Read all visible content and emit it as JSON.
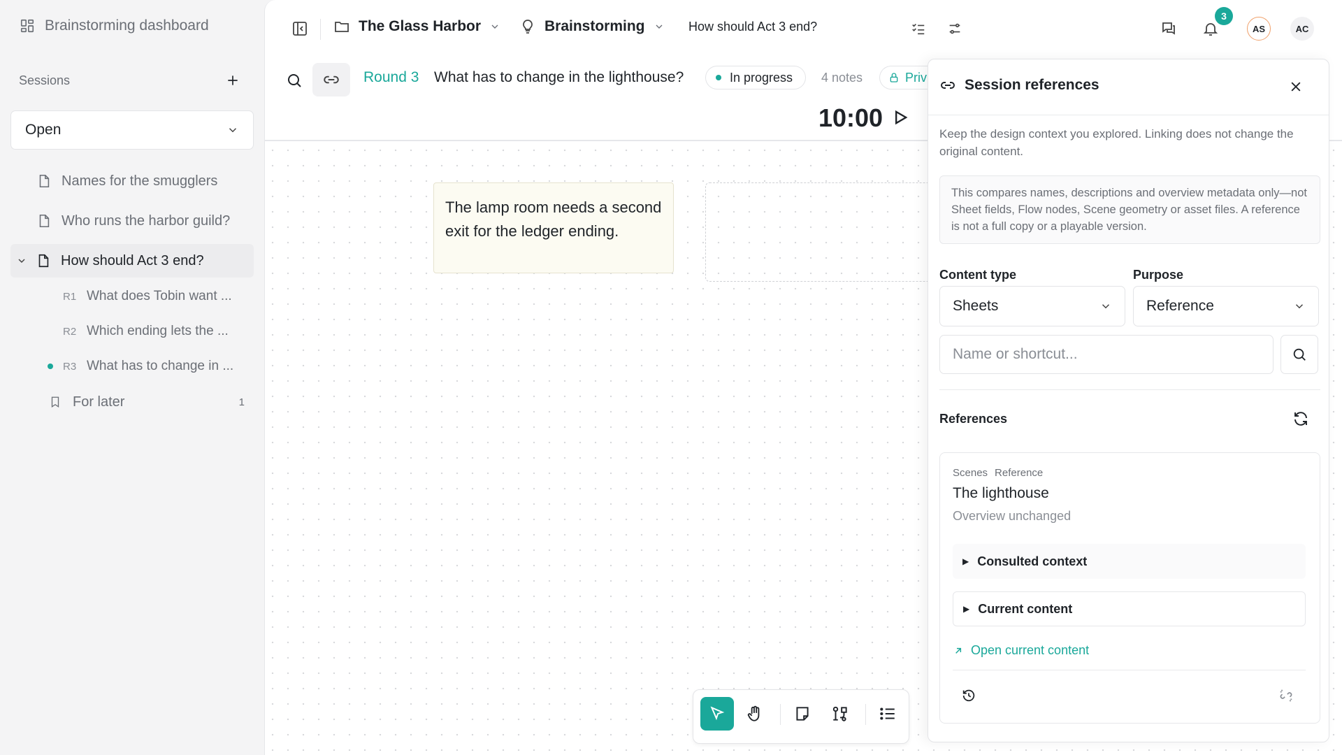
{
  "sidebar": {
    "dashboard_label": "Brainstorming dashboard",
    "sessions_label": "Sessions",
    "filter_value": "Open",
    "items": [
      {
        "label": "Names for the smugglers"
      },
      {
        "label": "Who runs the harbor guild?"
      },
      {
        "label": "How should Act 3 end?"
      }
    ],
    "rounds": [
      {
        "id": "R1",
        "label": "What does Tobin want ..."
      },
      {
        "id": "R2",
        "label": "Which ending lets the ..."
      },
      {
        "id": "R3",
        "label": "What has to change in ..."
      }
    ],
    "later_label": "For later",
    "later_count": "1"
  },
  "topbar": {
    "project": "The Glass Harbor",
    "mode": "Brainstorming",
    "question": "How should Act 3 end?",
    "notification_count": "3",
    "avatar_1": "AS",
    "avatar_2": "AC"
  },
  "round": {
    "label": "Round 3",
    "question": "What has to change in the lighthouse?",
    "status": "In progress",
    "notes": "4 notes",
    "privacy": "Priv",
    "timer": "10:00"
  },
  "canvas": {
    "sticky_text": "The lamp room needs a second exit for the ledger ending."
  },
  "drawer": {
    "title": "Session references",
    "description": "Keep the design context you explored. Linking does not change the original content.",
    "note": "This compares names, descriptions and overview metadata only—not Sheet fields, Flow nodes, Scene geometry or asset files. A reference is not a full copy or a playable version.",
    "content_type_label": "Content type",
    "content_type_value": "Sheets",
    "purpose_label": "Purpose",
    "purpose_value": "Reference",
    "search_placeholder": "Name or shortcut...",
    "references_label": "References",
    "reference": {
      "tag_type": "Scenes",
      "tag_purpose": "Reference",
      "name": "The lighthouse",
      "status": "Overview unchanged",
      "section_1": "Consulted context",
      "section_2": "Current content",
      "open_link": "Open current content"
    }
  },
  "colors": {
    "accent": "#1aa89a",
    "avatar_ring": "#f0a06a"
  }
}
